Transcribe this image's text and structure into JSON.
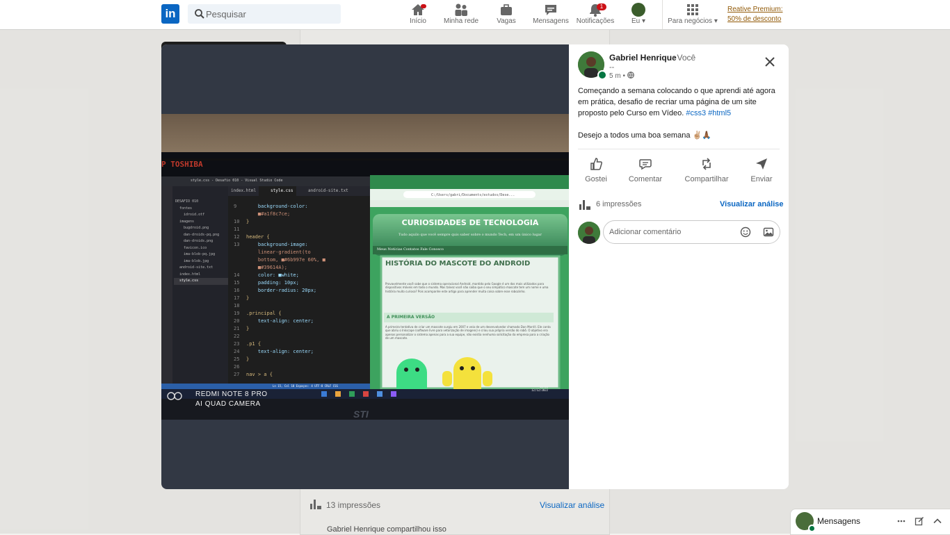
{
  "nav": {
    "search_placeholder": "Pesquisar",
    "items": [
      {
        "label": "Início",
        "icon": "home-icon",
        "badge": ""
      },
      {
        "label": "Minha rede",
        "icon": "network-icon",
        "badge": ""
      },
      {
        "label": "Vagas",
        "icon": "briefcase-icon",
        "badge": ""
      },
      {
        "label": "Mensagens",
        "icon": "chat-icon",
        "badge": ""
      },
      {
        "label": "Notificações",
        "icon": "bell-icon",
        "badge": "1"
      },
      {
        "label": "Eu",
        "icon": "avatar",
        "badge": ""
      },
      {
        "label": "Para negócios",
        "icon": "grid-icon",
        "badge": ""
      }
    ],
    "premium_line1": "Reative Premium:",
    "premium_line2": "50% de desconto"
  },
  "post": {
    "author": "Gabriel Henrique",
    "relation": "• Você",
    "subtitle": "--",
    "time": "5 m •",
    "text_p1": "Começando a semana colocando o que aprendi até agora em prática, desafio de recriar uma página de um site proposto pelo Curso em Vídeo.",
    "hashtags": "#css3 #html5",
    "text_p2": "Desejo a todos uma boa semana ✌🏼🙏🏾",
    "actions": [
      "Gostei",
      "Comentar",
      "Compartilhar",
      "Enviar"
    ],
    "impressions": "6 impressões",
    "analytics_link": "Visualizar análise",
    "comment_placeholder": "Adicionar comentário"
  },
  "background_feed": {
    "impressions": "13 impressões",
    "analytics_link": "Visualizar análise",
    "shared_by": "Gabriel Henrique compartilhou isso"
  },
  "messaging": {
    "title": "Mensagens"
  },
  "photo": {
    "watermark_line1": "REDMI NOTE 8 PRO",
    "watermark_line2": "AI QUAD CAMERA",
    "monitor_brand": "P TOSHIBA",
    "vscode_title": "style.css - Desafio 010 - Visual Studio Code",
    "explorer": [
      "DESAFIO 010",
      "fontes",
      "idroid.otf",
      "imagens",
      "bugdroid.png",
      "dan-droids-pq.png",
      "dan-droids.png",
      "favicon.ico",
      "ima-blob-pq.jpg",
      "ima-blob.jpg",
      "android-site.txt",
      "index.html",
      "style.css"
    ],
    "tabs": [
      "index.html",
      "style.css",
      "android-site.txt"
    ],
    "code_lines": [
      {
        "n": "9",
        "t": "    background-color:"
      },
      {
        "n": "",
        "t": "    ■#a1f8c7ce;"
      },
      {
        "n": "10",
        "t": "}"
      },
      {
        "n": "11",
        "t": ""
      },
      {
        "n": "12",
        "t": "header {"
      },
      {
        "n": "13",
        "t": "    background-image:"
      },
      {
        "n": "",
        "t": "    linear-gradient(to"
      },
      {
        "n": "",
        "t": "    bottom, ■#6b997e 60%, ■"
      },
      {
        "n": "",
        "t": "    ■#39614A);"
      },
      {
        "n": "14",
        "t": "    color: ■white;"
      },
      {
        "n": "15",
        "t": "    padding: 10px;"
      },
      {
        "n": "16",
        "t": "    border-radius: 20px;"
      },
      {
        "n": "17",
        "t": "}"
      },
      {
        "n": "18",
        "t": ""
      },
      {
        "n": "19",
        "t": ".principal {"
      },
      {
        "n": "20",
        "t": "    text-align: center;"
      },
      {
        "n": "21",
        "t": "}"
      },
      {
        "n": "22",
        "t": ""
      },
      {
        "n": "23",
        "t": ".p1 {"
      },
      {
        "n": "24",
        "t": "    text-align: center;"
      },
      {
        "n": "25",
        "t": "}"
      },
      {
        "n": "26",
        "t": ""
      },
      {
        "n": "27",
        "t": "nav > a {"
      }
    ],
    "browser_url": "C:/Users/gabri/Documents/estudos/Dese...",
    "site_title": "CURIOSIDADES DE TECNOLOGIA",
    "site_subtitle": "Tudo aquilo que você sempre quis saber sobre o mundo Tech, em um único lugar",
    "site_nav": "Meus Notícias Contatos Fale Conosco",
    "article_title": "HISTÓRIA DO MASCOTE DO ANDROID",
    "article_p1": "Provavelmente você sabe que o sistema operacional Android, mantido pelo Google é um dos mais utilizados para dispositivos móveis em todo o mundo. Mas talvez você não saiba que o seu simpático mascote tem um nome e uma história muito curiosa? Pois acompanhe este artigo para aprender muita coisa sobre esse robozinho.",
    "article_h2": "A PRIMEIRA VERSÃO",
    "article_p2": "A primeira tentativa de criar um mascote surgiu em 2007 e veio de um desenvolvedor chamado Dan Morrill. Ele conta que abriu o Inkscape (software livre para vetorização de imagens) e criou sua própria versão do robô. O objetivo era apenas personalizar o sistema apenas para a sua equipe, não existia nenhuma solicitação da empresa para a criação de um mascote.",
    "taskbar_time": "12:21",
    "taskbar_date": "12/12/2022",
    "statusbar": "Ln 15, Col 18  Espaços: 4  UTF-8  CRLF  CSS",
    "sti": "STI"
  },
  "colors": {
    "linkedin_blue": "#0a66c2",
    "online_green": "#057642",
    "badge_red": "#cc1016",
    "premium_gold": "#915907"
  }
}
